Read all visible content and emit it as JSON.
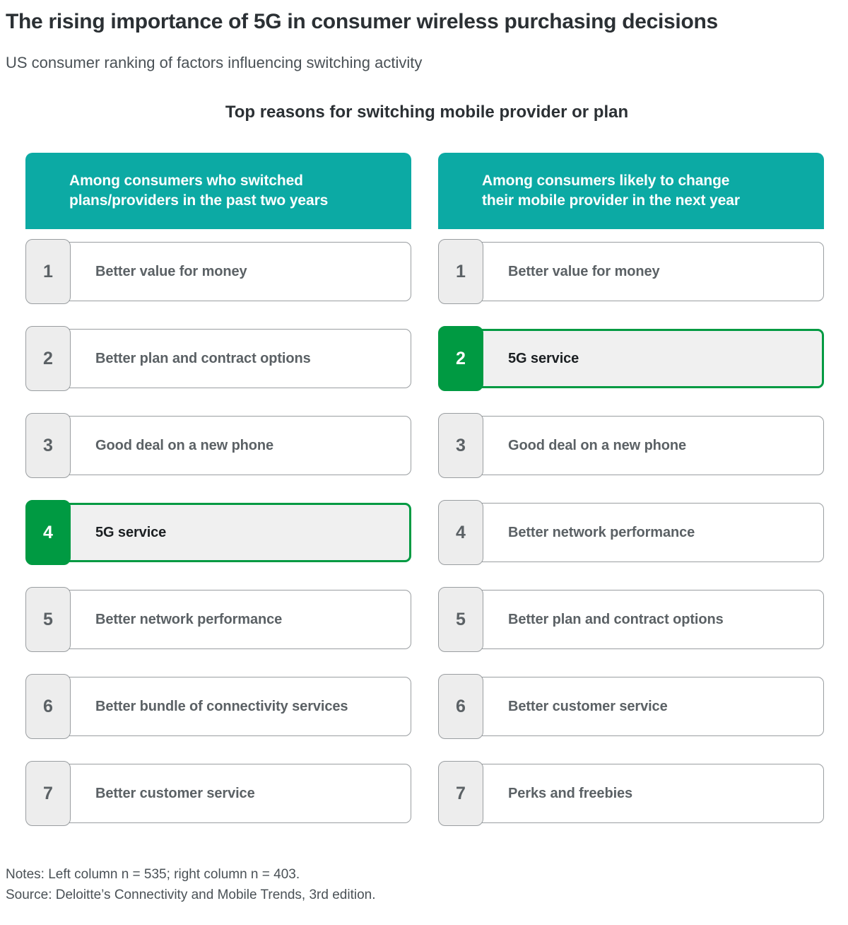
{
  "header": {
    "title": "The rising importance of 5G in consumer wireless purchasing decisions",
    "subtitle": "US consumer ranking of factors influencing switching activity"
  },
  "chart_data": {
    "type": "table",
    "title": "Top reasons for switching mobile provider or plan",
    "xlabel": "",
    "ylabel": "",
    "legend_position": "none",
    "grid": false,
    "columns": [
      {
        "header": "Among consumers who switched plans/providers in the past two years",
        "header_line1": "Among consumers who switched",
        "header_line2": "plans/providers in the past two years",
        "n": 535,
        "items": [
          {
            "rank": "1",
            "label": "Better value for money",
            "highlight": false
          },
          {
            "rank": "2",
            "label": "Better plan and contract options",
            "highlight": false
          },
          {
            "rank": "3",
            "label": "Good deal on a new phone",
            "highlight": false
          },
          {
            "rank": "4",
            "label": "5G service",
            "highlight": true
          },
          {
            "rank": "5",
            "label": "Better network performance",
            "highlight": false
          },
          {
            "rank": "6",
            "label": "Better bundle of connectivity services",
            "highlight": false
          },
          {
            "rank": "7",
            "label": "Better customer service",
            "highlight": false
          }
        ]
      },
      {
        "header": "Among consumers likely to change their mobile provider in the next year",
        "header_line1": "Among consumers likely to change",
        "header_line2": "their mobile provider in the next year",
        "n": 403,
        "items": [
          {
            "rank": "1",
            "label": "Better value for money",
            "highlight": false
          },
          {
            "rank": "2",
            "label": "5G service",
            "highlight": true
          },
          {
            "rank": "3",
            "label": "Good deal on a new phone",
            "highlight": false
          },
          {
            "rank": "4",
            "label": "Better network performance",
            "highlight": false
          },
          {
            "rank": "5",
            "label": "Better plan and contract options",
            "highlight": false
          },
          {
            "rank": "6",
            "label": "Better customer service",
            "highlight": false
          },
          {
            "rank": "7",
            "label": "Perks and freebies",
            "highlight": false
          }
        ]
      }
    ]
  },
  "footnotes": {
    "notes": "Notes: Left column n = 535; right column n = 403.",
    "source": "Source: Deloitte’s Connectivity and Mobile Trends, 3rd edition."
  },
  "colors": {
    "header_teal": "#0caaa4",
    "highlight_green": "#009a42",
    "chip_gray": "#ededed",
    "border_gray": "#9a9ea1",
    "text_dark": "#2b3034",
    "text_gray": "#5b6165"
  }
}
